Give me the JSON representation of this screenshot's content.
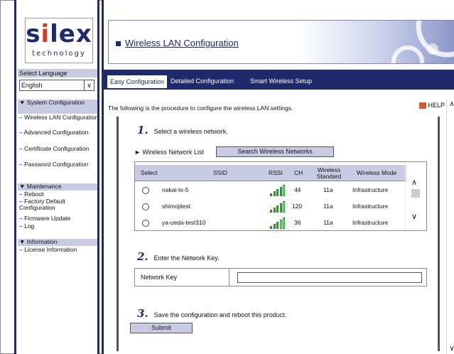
{
  "logo": {
    "brand": "silex",
    "tagline": "technology"
  },
  "sidebar": {
    "select_language_label": "Select Language",
    "language_value": "English",
    "sections": [
      {
        "title": "▼ System Configuration",
        "items": [
          "– Wireless LAN Configuration",
          "– Advanced Configuration",
          "– Certificate Configuration",
          "– Password Configuration"
        ]
      },
      {
        "title": "▼ Maintenance",
        "items": [
          "– Reboot",
          "– Factory Default Configuration",
          "– Firmware Update",
          "– Log"
        ]
      },
      {
        "title": "▼ Information",
        "items": [
          "– License Information"
        ]
      }
    ]
  },
  "page": {
    "title": "Wireless LAN Configuration"
  },
  "tabs": [
    "Easy Configuration",
    "Detailed Configuration",
    "Smart Wireless Setup"
  ],
  "content": {
    "intro": "The following is the procedure to configure the wireless LAN settings.",
    "help_label": "HELP",
    "step1": {
      "num": "1.",
      "text": "Select a wireless network."
    },
    "wireless_network_list_label": "► Wireless Network List",
    "search_button": "Search Wireless Networks",
    "table": {
      "headers": [
        "Select",
        "SSID",
        "RSSI",
        "CH",
        "Wireless Standard",
        "Wireless Mode"
      ],
      "rows": [
        {
          "ssid": "nakai-lo-5",
          "ch": "44",
          "standard": "11a",
          "mode": "Infrastructure",
          "rssi_bars": 4
        },
        {
          "ssid": "shimojitest",
          "ch": "120",
          "standard": "11a",
          "mode": "Infrastructure",
          "rssi_bars": 4
        },
        {
          "ssid": "ya-ueda-test310",
          "ch": "36",
          "standard": "11a",
          "mode": "Infrastructure",
          "rssi_bars": 3
        }
      ]
    },
    "step2": {
      "num": "2.",
      "text": "Enter the Network Key."
    },
    "network_key_label": "Network Key",
    "network_key_value": "",
    "step3": {
      "num": "3.",
      "text": "Save the configuration and reboot this product."
    },
    "submit_button": "Submit"
  },
  "colors": {
    "navy": "#1f2a6a",
    "lavender": "#c9cbe4",
    "logo_red": "#d23a2a",
    "signal_green": "#3da33d"
  }
}
